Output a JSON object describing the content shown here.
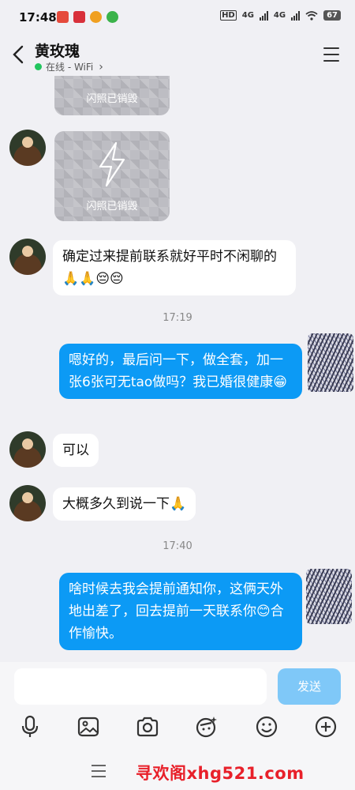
{
  "status": {
    "time": "17:48",
    "net1": "HD",
    "net2": "4G",
    "net3": "4G",
    "battery": "67"
  },
  "header": {
    "contact_name": "黄玫瑰",
    "presence": "在线 - WiFi",
    "presence_arrow": "›"
  },
  "messages": {
    "snap_destroyed_1": "闪照已销毁",
    "snap_destroyed_2": "闪照已销毁",
    "in_1": "确定过来提前联系就好平时不闲聊的🙏🙏😔😔",
    "time_1": "17:19",
    "out_1": "嗯好的，最后问一下，做全套，加一张6张可无tao做吗？我已婚很健康😁",
    "in_2": "可以",
    "in_3": "大概多久到说一下🙏",
    "time_2": "17:40",
    "out_2": "啥时候去我会提前通知你，这俩天外地出差了，回去提前一天联系你😊合作愉快。"
  },
  "composer": {
    "input_value": "",
    "send_label": "发送"
  },
  "toolbar": {
    "icons": [
      "microphone-icon",
      "image-icon",
      "camera-icon",
      "sticker-icon",
      "emoji-icon",
      "plus-icon"
    ]
  },
  "footer": {
    "watermark": "寻欢阁xhg521.com"
  },
  "colors": {
    "accent": "#0c9af5",
    "send_disabled": "#7fc8f8",
    "online": "#22c55e",
    "watermark": "#e8202a"
  }
}
